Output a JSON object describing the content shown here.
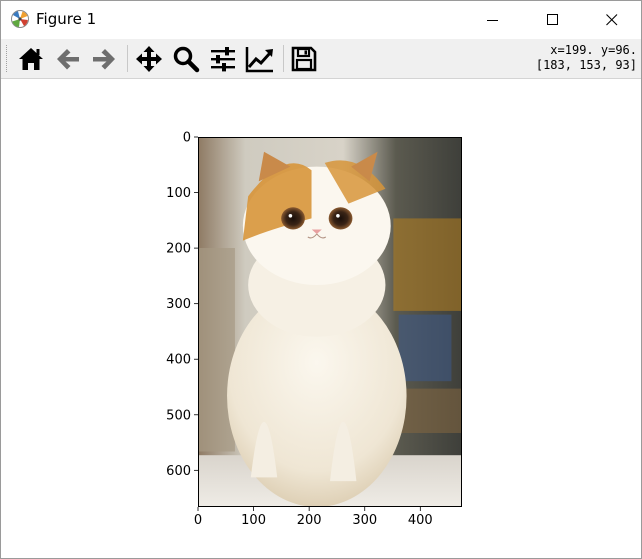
{
  "window": {
    "title": "Figure 1",
    "controls": [
      "minimize-icon",
      "maximize-icon",
      "close-icon"
    ]
  },
  "toolbar": {
    "buttons": [
      {
        "name": "home",
        "icon": "home-icon"
      },
      {
        "name": "back",
        "icon": "arrow-left-icon"
      },
      {
        "name": "forward",
        "icon": "arrow-right-icon"
      },
      {
        "name": "pan",
        "icon": "move-arrows-icon"
      },
      {
        "name": "zoom",
        "icon": "magnifier-icon"
      },
      {
        "name": "configure-subplots",
        "icon": "sliders-icon"
      },
      {
        "name": "edit-axis",
        "icon": "line-chart-icon"
      },
      {
        "name": "save",
        "icon": "floppy-disk-icon"
      }
    ],
    "cursor_position": "x=199. y=96.",
    "pixel_value": "[183, 153, 93]"
  },
  "chart_data": {
    "type": "image",
    "image_subject": "cat-photo",
    "image_width": 475,
    "image_height": 666,
    "xlim": [
      0,
      475
    ],
    "ylim": [
      666,
      0
    ],
    "y_inverted": true,
    "xticks": [
      0,
      100,
      200,
      300,
      400
    ],
    "yticks": [
      0,
      100,
      200,
      300,
      400,
      500,
      600
    ],
    "grid": false
  },
  "colors": {
    "toolbar_bg": "#f0f0f0",
    "icon": "#000000",
    "icon_disabled": "#7a7a7a"
  }
}
